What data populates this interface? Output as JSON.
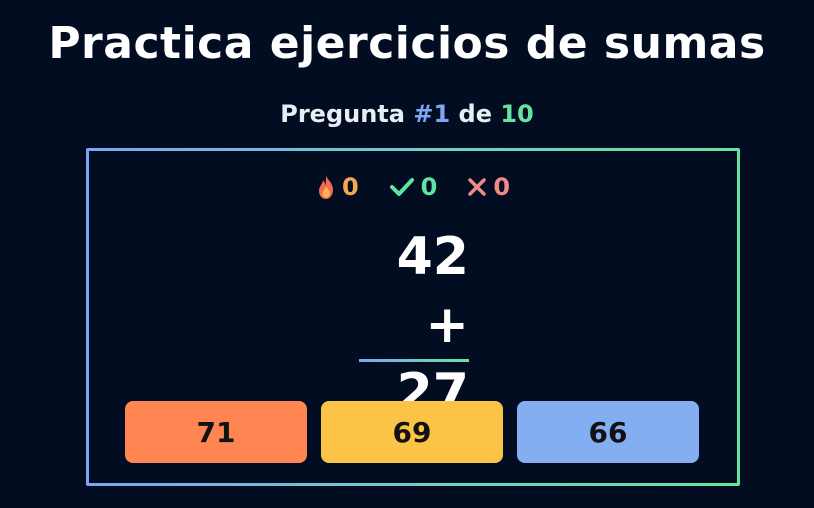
{
  "header": {
    "title": "Practica ejercicios de sumas",
    "question_prefix": "Pregunta",
    "question_number": "#1",
    "question_of": "de",
    "question_total": "10"
  },
  "stats": {
    "streak": "0",
    "correct": "0",
    "wrong": "0"
  },
  "problem": {
    "top": "42",
    "operator": "+",
    "bottom": "27"
  },
  "answers": [
    {
      "label": "71",
      "color": "#ff8553"
    },
    {
      "label": "69",
      "color": "#fbc446"
    },
    {
      "label": "66",
      "color": "#84aef2"
    }
  ],
  "colors": {
    "background": "#020d21",
    "accent_blue": "#7ea6f2",
    "accent_green": "#66e3a0",
    "streak": "#f6a64e",
    "correct": "#5fe3a0",
    "wrong": "#f08a8a"
  },
  "icons": {
    "streak": "fire-icon",
    "correct": "check-icon",
    "wrong": "x-icon"
  }
}
